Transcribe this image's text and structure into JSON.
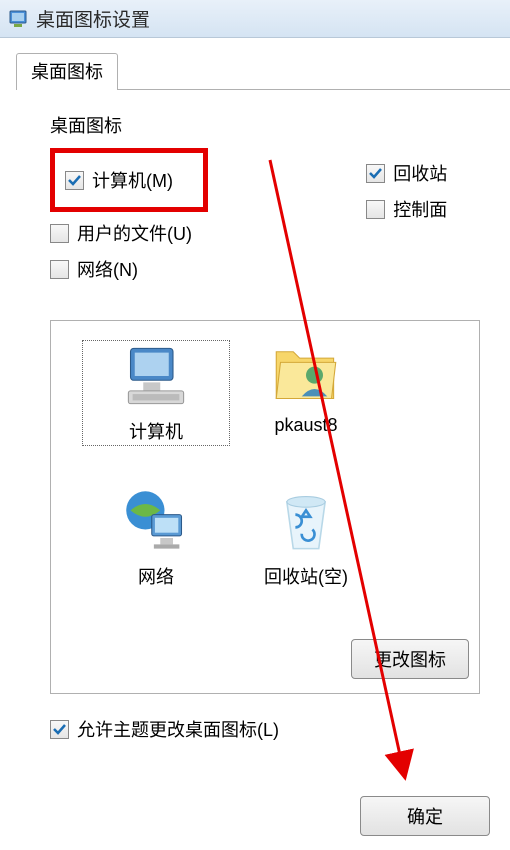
{
  "window": {
    "title": "桌面图标设置"
  },
  "tab": {
    "label": "桌面图标"
  },
  "group": {
    "label": "桌面图标"
  },
  "checks": {
    "computer": {
      "label": "计算机(M)",
      "checked": true
    },
    "userfiles": {
      "label": "用户的文件(U)",
      "checked": false
    },
    "network": {
      "label": "网络(N)",
      "checked": false
    },
    "recycle": {
      "label": "回收站",
      "checked": true
    },
    "control": {
      "label": "控制面",
      "checked": false
    }
  },
  "icons": {
    "computer": "计算机",
    "user": "pkaust8",
    "network": "网络",
    "recycle_empty": "回收站(空)"
  },
  "buttons": {
    "change_icon": "更改图标",
    "ok": "确定"
  },
  "allow_theme": {
    "label": "允许主题更改桌面图标(L)",
    "checked": true
  }
}
